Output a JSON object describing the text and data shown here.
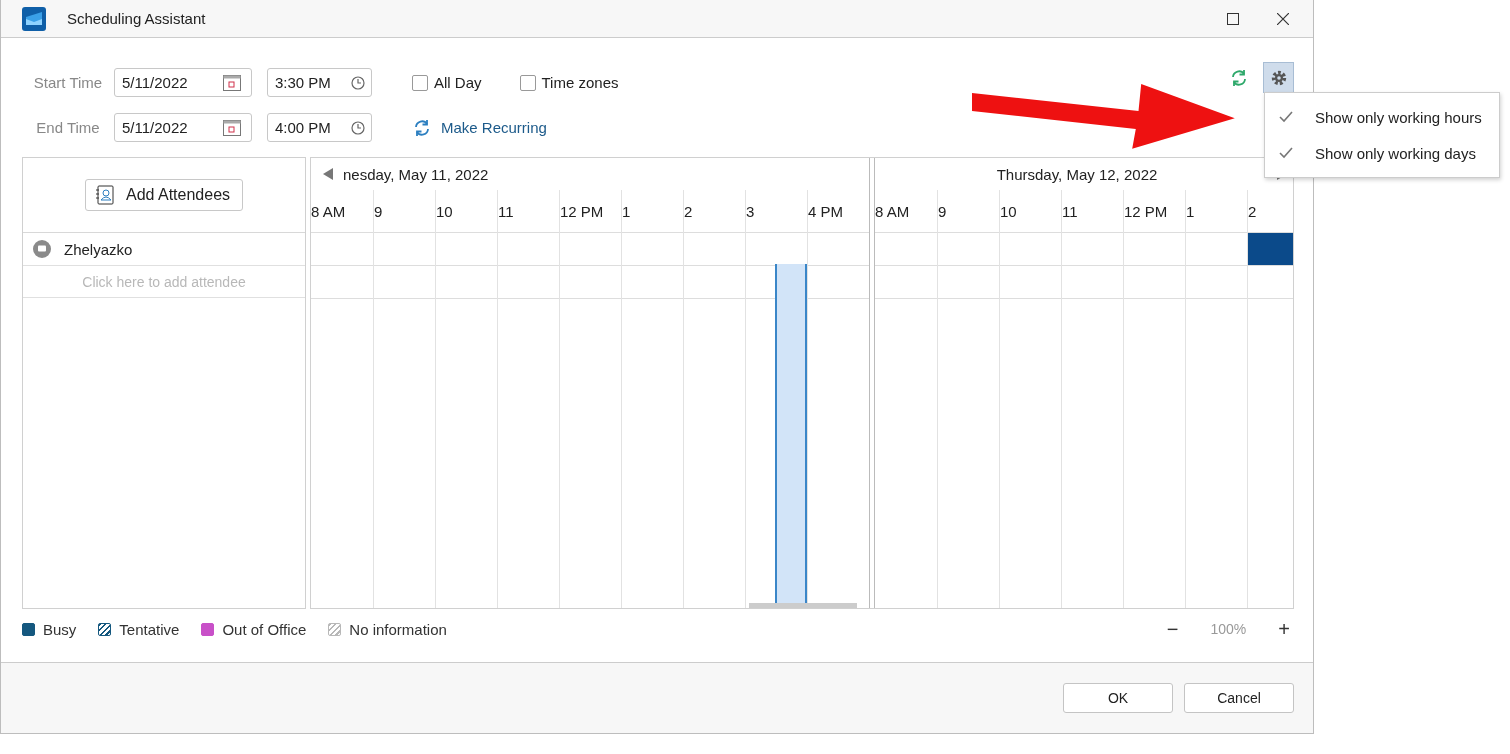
{
  "window": {
    "title": "Scheduling Assistant"
  },
  "form": {
    "start": {
      "label": "Start Time",
      "date": "5/11/2022",
      "time": "3:30 PM"
    },
    "end": {
      "label": "End Time",
      "date": "5/11/2022",
      "time": "4:00 PM"
    },
    "options": [
      {
        "label": "All Day",
        "checked": false
      },
      {
        "label": "Time zones",
        "checked": false
      }
    ],
    "recurring_link": "Make Recurring"
  },
  "settings_menu": {
    "items": [
      {
        "label": "Show only working hours",
        "checked": true
      },
      {
        "label": "Show only working days",
        "checked": true
      }
    ]
  },
  "attendees": {
    "add_button": "Add Attendees",
    "list": [
      {
        "name": "Zhelyazko"
      }
    ],
    "add_placeholder": "Click here to add attendee"
  },
  "schedule": {
    "days": [
      {
        "title": "nesday, May 11, 2022",
        "hours": [
          {
            "label": "8 AM",
            "busy": false,
            "half_hours": [
              {
                "selected": false
              },
              {
                "selected": false
              }
            ]
          },
          {
            "label": "9",
            "busy": false,
            "half_hours": [
              {
                "selected": false
              },
              {
                "selected": false
              }
            ]
          },
          {
            "label": "10",
            "busy": false,
            "half_hours": [
              {
                "selected": false
              },
              {
                "selected": false
              }
            ]
          },
          {
            "label": "11",
            "busy": false,
            "half_hours": [
              {
                "selected": false
              },
              {
                "selected": false
              }
            ]
          },
          {
            "label": "12 PM",
            "busy": false,
            "half_hours": [
              {
                "selected": false
              },
              {
                "selected": false
              }
            ]
          },
          {
            "label": "1",
            "busy": false,
            "half_hours": [
              {
                "selected": false
              },
              {
                "selected": false
              }
            ]
          },
          {
            "label": "2",
            "busy": false,
            "half_hours": [
              {
                "selected": false
              },
              {
                "selected": false
              }
            ]
          },
          {
            "label": "3",
            "busy": false,
            "half_hours": [
              {
                "selected": false
              },
              {
                "selected": true
              }
            ]
          },
          {
            "label": "4 PM",
            "busy": false,
            "half_hours": [
              {
                "selected": false
              },
              {
                "selected": false
              }
            ]
          }
        ]
      },
      {
        "title": "Thursday, May 12, 2022",
        "hours": [
          {
            "label": "8 AM",
            "busy": false,
            "half_hours": [
              {
                "selected": false
              },
              {
                "selected": false
              }
            ]
          },
          {
            "label": "9",
            "busy": false,
            "half_hours": [
              {
                "selected": false
              },
              {
                "selected": false
              }
            ]
          },
          {
            "label": "10",
            "busy": false,
            "half_hours": [
              {
                "selected": false
              },
              {
                "selected": false
              }
            ]
          },
          {
            "label": "11",
            "busy": false,
            "half_hours": [
              {
                "selected": false
              },
              {
                "selected": false
              }
            ]
          },
          {
            "label": "12 PM",
            "busy": false,
            "half_hours": [
              {
                "selected": false
              },
              {
                "selected": false
              }
            ]
          },
          {
            "label": "1",
            "busy": false,
            "half_hours": [
              {
                "selected": false
              },
              {
                "selected": false
              }
            ]
          },
          {
            "label": "2",
            "busy": true,
            "half_hours": [
              {
                "selected": false
              },
              {
                "selected": false
              }
            ]
          }
        ]
      }
    ]
  },
  "legend": [
    {
      "label": "Busy",
      "kind": "solid",
      "color": "#15587f"
    },
    {
      "label": "Tentative",
      "kind": "hatched",
      "color": "#15587f"
    },
    {
      "label": "Out of Office",
      "kind": "solid",
      "color": "#c850c8"
    },
    {
      "label": "No information",
      "kind": "hatched",
      "color": "#b8b8b8"
    }
  ],
  "zoom": {
    "minus": "−",
    "value": "100%",
    "plus": "+"
  },
  "buttons": [
    "OK",
    "Cancel"
  ]
}
